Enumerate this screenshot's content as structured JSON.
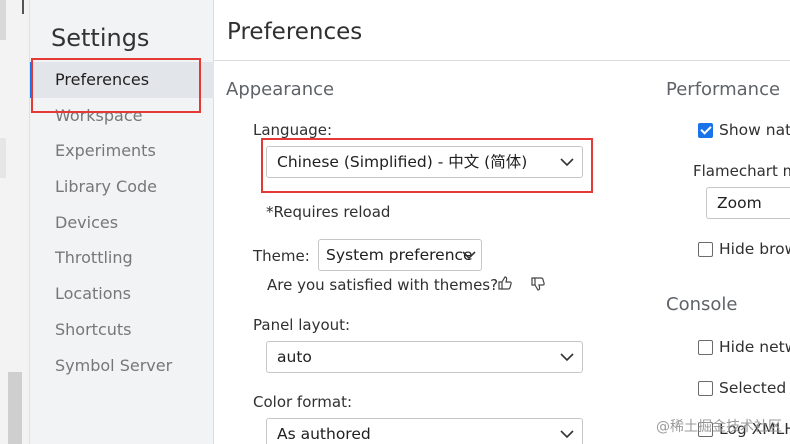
{
  "sidebar": {
    "title": "Settings",
    "items": [
      {
        "label": "Preferences"
      },
      {
        "label": "Workspace"
      },
      {
        "label": "Experiments"
      },
      {
        "label": "Library Code"
      },
      {
        "label": "Devices"
      },
      {
        "label": "Throttling"
      },
      {
        "label": "Locations"
      },
      {
        "label": "Shortcuts"
      },
      {
        "label": "Symbol Server"
      }
    ]
  },
  "main": {
    "title": "Preferences",
    "appearance": {
      "section_title": "Appearance",
      "language_label": "Language:",
      "language_value": "Chinese (Simplified) - 中文 (简体)",
      "requires_reload": "*Requires reload",
      "theme_label": "Theme:",
      "theme_value": "System preference",
      "theme_feedback": "Are you satisfied with themes?",
      "panel_layout_label": "Panel layout:",
      "panel_layout_value": "auto",
      "color_format_label": "Color format:",
      "color_format_value": "As authored"
    },
    "performance": {
      "section_title": "Performance",
      "show_native": "Show nati",
      "flamechart_label": "Flamechart m",
      "flamechart_value": "Zoom",
      "hide_browser": "Hide brow"
    },
    "console": {
      "section_title": "Console",
      "hide_network": "Hide netw",
      "selected_context": "Selected c",
      "log_xmlhttp": "Log XMLH"
    }
  },
  "watermark": "@稀土掘金技术社区",
  "colors": {
    "accent": "#1a73e8",
    "highlight_box": "#e53935",
    "sidebar_bg": "#f1f3f4"
  },
  "icons": [
    "chevron-down-icon",
    "thumbs-up-icon",
    "thumbs-down-icon",
    "checkbox-icon"
  ]
}
